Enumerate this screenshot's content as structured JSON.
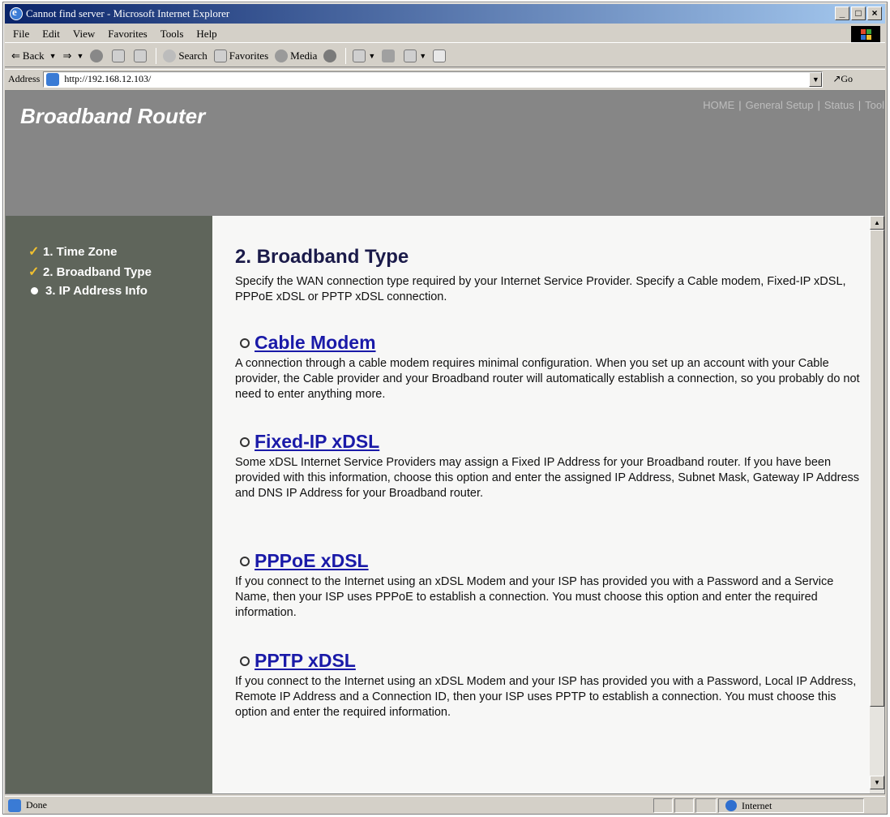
{
  "window": {
    "title": "Cannot find server - Microsoft Internet Explorer",
    "controls": {
      "minimize": "_",
      "maximize": "□",
      "close": "×"
    }
  },
  "menu": [
    "File",
    "Edit",
    "View",
    "Favorites",
    "Tools",
    "Help"
  ],
  "toolbar": {
    "back": "Back",
    "search": "Search",
    "favorites": "Favorites",
    "media": "Media"
  },
  "address": {
    "label": "Address",
    "url": "http://192.168.12.103/",
    "go": "Go"
  },
  "banner": {
    "title": "Broadband Router",
    "nav": [
      "HOME",
      "General Setup",
      "Status",
      "Tool"
    ]
  },
  "sidebar": {
    "steps": [
      {
        "label": "1. Time Zone",
        "state": "done"
      },
      {
        "label": "2. Broadband Type",
        "state": "done"
      },
      {
        "label": "3. IP Address Info",
        "state": "current"
      }
    ]
  },
  "main": {
    "heading": "2. Broadband Type",
    "intro": "Specify the WAN connection type required by your Internet Service Provider. Specify a Cable modem, Fixed-IP xDSL, PPPoE xDSL or PPTP xDSL connection.",
    "options": [
      {
        "title": "Cable Modem",
        "desc": "A connection through a cable modem requires minimal configuration. When you set up an account with your Cable provider, the Cable provider and your Broadband router will automatically establish a connection, so you probably do not need to enter anything more."
      },
      {
        "title": "Fixed-IP xDSL",
        "desc": "Some xDSL Internet Service Providers may assign a Fixed IP Address for your Broadband router. If you have been provided with this information, choose this option and enter the assigned IP Address, Subnet Mask, Gateway IP Address and DNS IP Address for your Broadband router."
      },
      {
        "title": "PPPoE xDSL",
        "desc": "If you connect to the Internet using an xDSL Modem and your ISP has provided you with a Password and a Service Name, then your ISP uses PPPoE to establish a connection. You must choose this option and enter the required information."
      },
      {
        "title": "PPTP xDSL",
        "desc": "If you connect to the Internet using an xDSL Modem and your ISP has provided you with a Password, Local IP Address, Remote IP Address and a Connection ID, then your ISP uses PPTP to establish a connection. You must choose this option and enter the required information."
      }
    ]
  },
  "status": {
    "text": "Done",
    "zone": "Internet"
  },
  "colors": {
    "banner_bg": "#868686",
    "sidebar_bg": "#5f655b",
    "link": "#1a1aa8",
    "heading": "#1b1b4a",
    "check": "#f0c030"
  }
}
